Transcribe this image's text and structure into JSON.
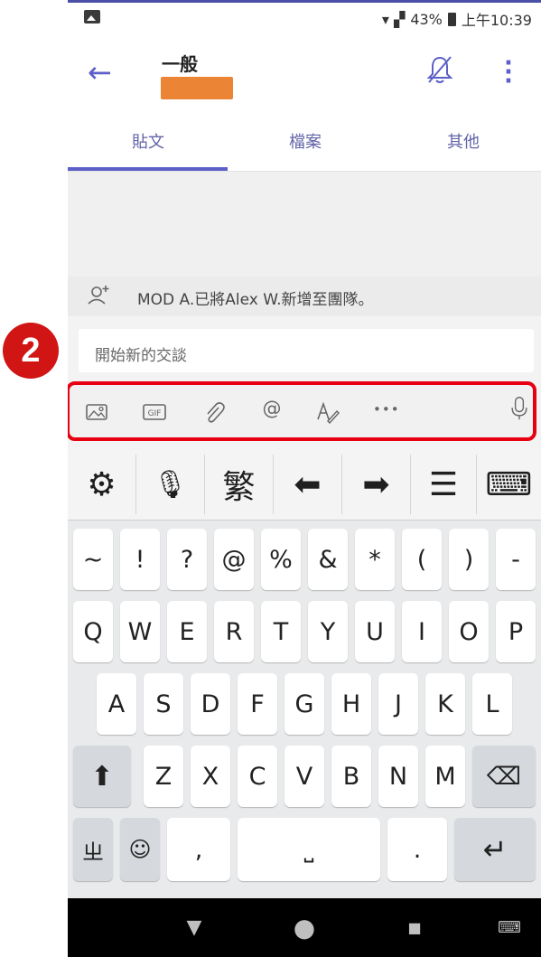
{
  "status_bar": {
    "signal_icon": "wifi-signal-icon",
    "battery": "43%",
    "time": "上午10:39"
  },
  "header": {
    "channel_name": "一般",
    "back_icon": "arrow-left-icon",
    "mute_icon": "bell-off-icon",
    "more_icon": "more-vertical-icon"
  },
  "tabs": [
    {
      "label": "貼文",
      "active": true
    },
    {
      "label": "檔案",
      "active": false
    },
    {
      "label": "其他",
      "active": false
    }
  ],
  "system_message": {
    "icon": "add-person-icon",
    "text": "MOD A.已將Alex W.新增至團隊。"
  },
  "compose": {
    "placeholder": "開始新的交談",
    "toolbar": [
      {
        "name": "image-icon"
      },
      {
        "name": "gif-icon",
        "label": "GIF"
      },
      {
        "name": "attach-icon"
      },
      {
        "name": "mention-icon",
        "label": "@"
      },
      {
        "name": "format-icon"
      },
      {
        "name": "more-horizontal-icon",
        "label": "•••"
      },
      {
        "name": "microphone-icon"
      }
    ]
  },
  "badge": {
    "label": "2"
  },
  "keyboard": {
    "function_row": [
      {
        "name": "settings-icon",
        "label": "⚙"
      },
      {
        "name": "microphone-key-icon",
        "label": "🎙"
      },
      {
        "name": "traditional-mode-key",
        "label": "繁"
      },
      {
        "name": "cursor-left-icon",
        "label": "⬅"
      },
      {
        "name": "cursor-right-icon",
        "label": "➡"
      },
      {
        "name": "clipboard-icon",
        "label": "☰"
      },
      {
        "name": "hide-keyboard-icon",
        "label": "⌨"
      }
    ],
    "symbols": [
      "~",
      "!",
      "?",
      "@",
      "%",
      "&",
      "*",
      "(",
      ")",
      "-"
    ],
    "row1": [
      "Q",
      "W",
      "E",
      "R",
      "T",
      "Y",
      "U",
      "I",
      "O",
      "P"
    ],
    "row2": [
      "A",
      "S",
      "D",
      "F",
      "G",
      "H",
      "J",
      "K",
      "L"
    ],
    "row3": [
      "Z",
      "X",
      "C",
      "V",
      "B",
      "N",
      "M"
    ],
    "shift_label": "⬆",
    "backspace_label": "⌫",
    "zhuyin_label": "ㄓ",
    "emoji_label": "☺",
    "comma_label": ",",
    "space_label": "⎵",
    "period_label": ".",
    "enter_label": "↵"
  },
  "nav_bar": {
    "back": "▼",
    "home": "●",
    "recents": "■",
    "keyboard": "⌨"
  },
  "colors": {
    "accent": "#5b5fc7",
    "highlight": "#e60012",
    "redaction": "#ec8436"
  }
}
